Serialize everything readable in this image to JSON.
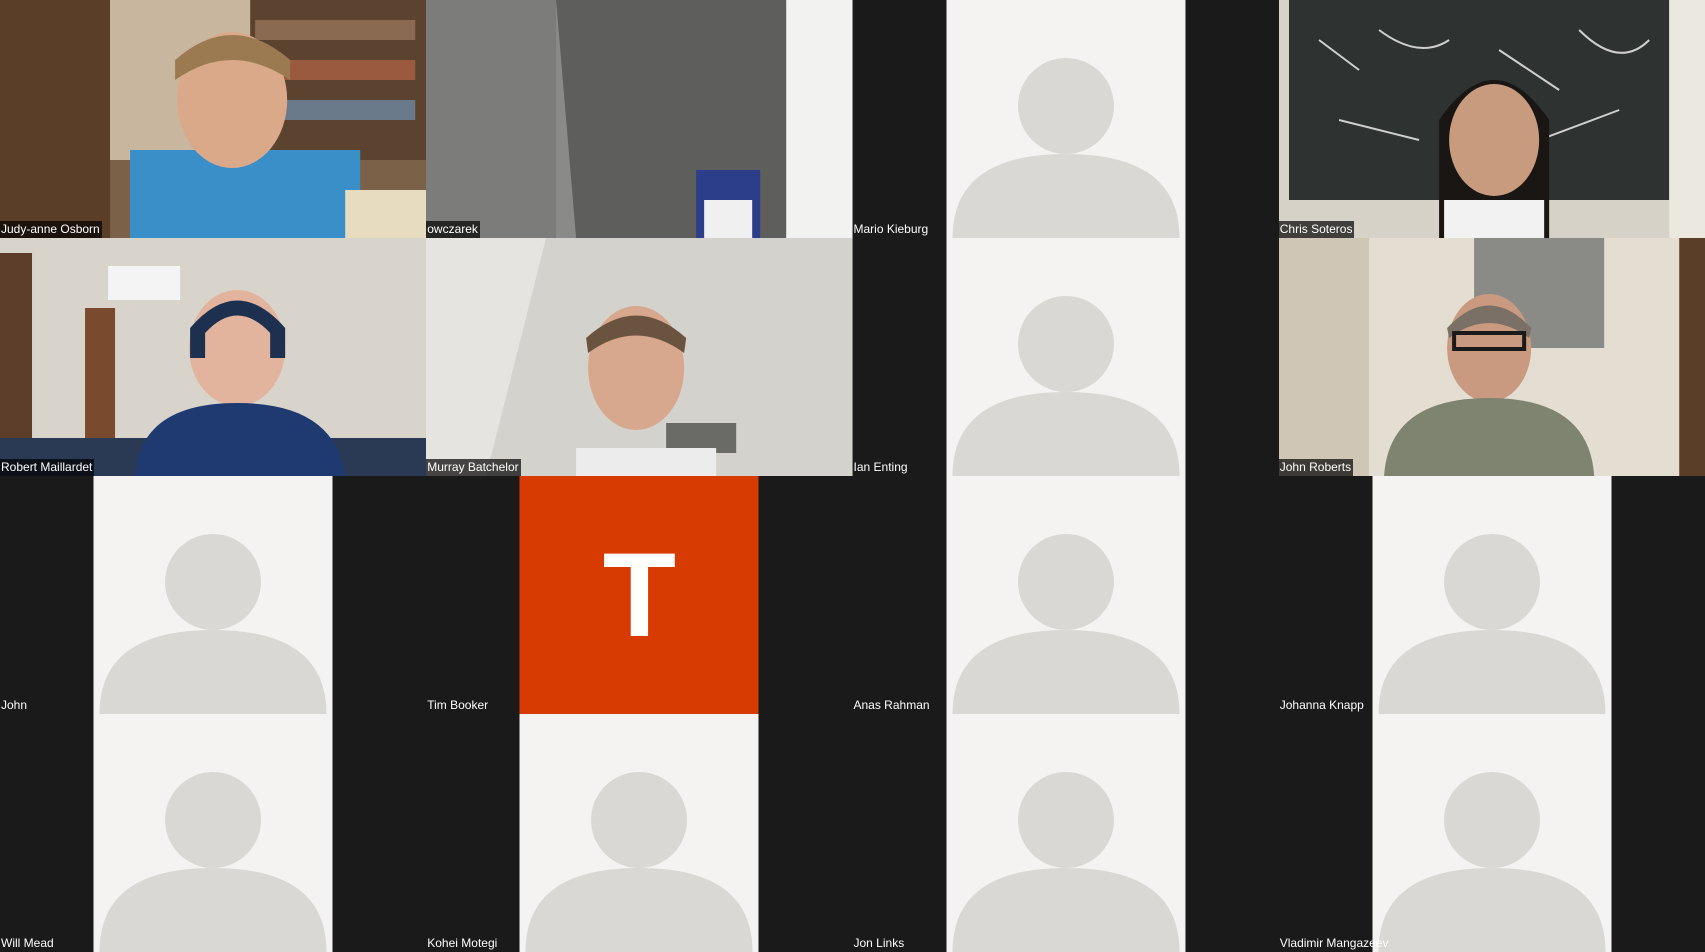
{
  "meeting": {
    "view": "gallery",
    "participants": [
      {
        "name": "Judy-anne Osborn",
        "video": true,
        "tile_type": "video"
      },
      {
        "name": "owczarek",
        "video": true,
        "tile_type": "video"
      },
      {
        "name": "Mario Kieburg",
        "video": false,
        "tile_type": "avatar"
      },
      {
        "name": "Chris Soteros",
        "video": true,
        "tile_type": "video"
      },
      {
        "name": "Robert Maillardet",
        "video": true,
        "tile_type": "video"
      },
      {
        "name": "Murray Batchelor",
        "video": true,
        "tile_type": "video"
      },
      {
        "name": "Ian Enting",
        "video": false,
        "tile_type": "avatar"
      },
      {
        "name": "John Roberts",
        "video": true,
        "tile_type": "video"
      },
      {
        "name": "John",
        "video": false,
        "tile_type": "avatar"
      },
      {
        "name": "Tim Booker",
        "video": false,
        "tile_type": "initial",
        "initial": "T"
      },
      {
        "name": "Anas Rahman",
        "video": false,
        "tile_type": "avatar"
      },
      {
        "name": "Johanna Knapp",
        "video": false,
        "tile_type": "avatar"
      },
      {
        "name": "Will Mead",
        "video": false,
        "tile_type": "avatar"
      },
      {
        "name": "Kohei Motegi",
        "video": false,
        "tile_type": "avatar"
      },
      {
        "name": "Jon Links",
        "video": false,
        "tile_type": "avatar"
      },
      {
        "name": "Vladimir Mangazeev",
        "video": false,
        "tile_type": "avatar"
      }
    ]
  },
  "colors": {
    "tile_background": "#1a1a1a",
    "avatar_background": "#f4f3f1",
    "avatar_silhouette": "#d9d8d4",
    "initial_background": "#d83b01",
    "name_label_text": "#ffffff"
  }
}
